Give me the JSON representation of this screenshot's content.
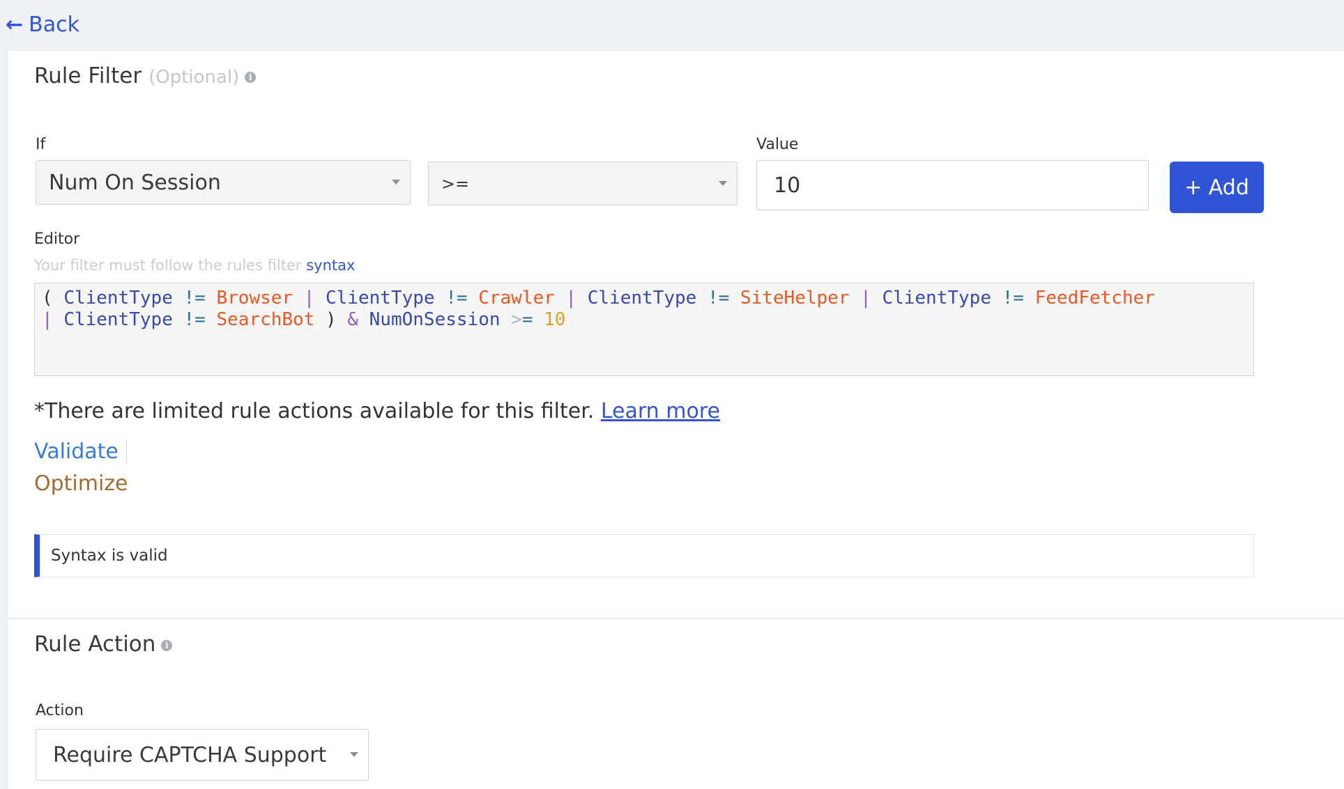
{
  "nav": {
    "back_label": "Back"
  },
  "rule_filter": {
    "title": "Rule Filter",
    "optional": "(Optional)",
    "if_label": "If",
    "field_value": "Num On Session",
    "operator_value": ">=",
    "value_label": "Value",
    "value_input": "10",
    "add_label": "+ Add",
    "editor_label": "Editor",
    "hint_text": "Your filter must follow the rules filter ",
    "hint_link": "syntax",
    "editor_lines": [
      [
        {
          "t": "( ",
          "c": "p"
        },
        {
          "t": "ClientType",
          "c": "f"
        },
        {
          "t": " != ",
          "c": "op"
        },
        {
          "t": "Browser",
          "c": "s"
        },
        {
          "t": " | ",
          "c": "o"
        },
        {
          "t": "ClientType",
          "c": "f"
        },
        {
          "t": " != ",
          "c": "op"
        },
        {
          "t": "Crawler",
          "c": "s"
        },
        {
          "t": " | ",
          "c": "o"
        },
        {
          "t": "ClientType",
          "c": "f"
        },
        {
          "t": " != ",
          "c": "op"
        },
        {
          "t": "SiteHelper",
          "c": "s"
        },
        {
          "t": " | ",
          "c": "o"
        },
        {
          "t": "ClientType",
          "c": "f"
        },
        {
          "t": " != ",
          "c": "op"
        },
        {
          "t": "FeedFetcher",
          "c": "s"
        }
      ],
      [
        {
          "t": "| ",
          "c": "o"
        },
        {
          "t": "ClientType",
          "c": "f"
        },
        {
          "t": " != ",
          "c": "op"
        },
        {
          "t": "SearchBot",
          "c": "s"
        },
        {
          "t": " ) ",
          "c": "p"
        },
        {
          "t": "& ",
          "c": "o"
        },
        {
          "t": "NumOnSession",
          "c": "f"
        },
        {
          "t": " >",
          "c": "g"
        },
        {
          "t": "= ",
          "c": "op"
        },
        {
          "t": "10",
          "c": "n"
        }
      ]
    ],
    "note_text": "*There are limited rule actions available for this filter. ",
    "learn_more": "Learn more",
    "validate_label": "Validate",
    "optimize_label": "Optimize",
    "status_text": "Syntax is valid"
  },
  "rule_action": {
    "title": "Rule Action",
    "action_label": "Action",
    "action_value": "Require CAPTCHA Support"
  },
  "colors": {
    "accent": "#2f55d4",
    "link": "#3454d1",
    "optimize": "#a36a32"
  }
}
